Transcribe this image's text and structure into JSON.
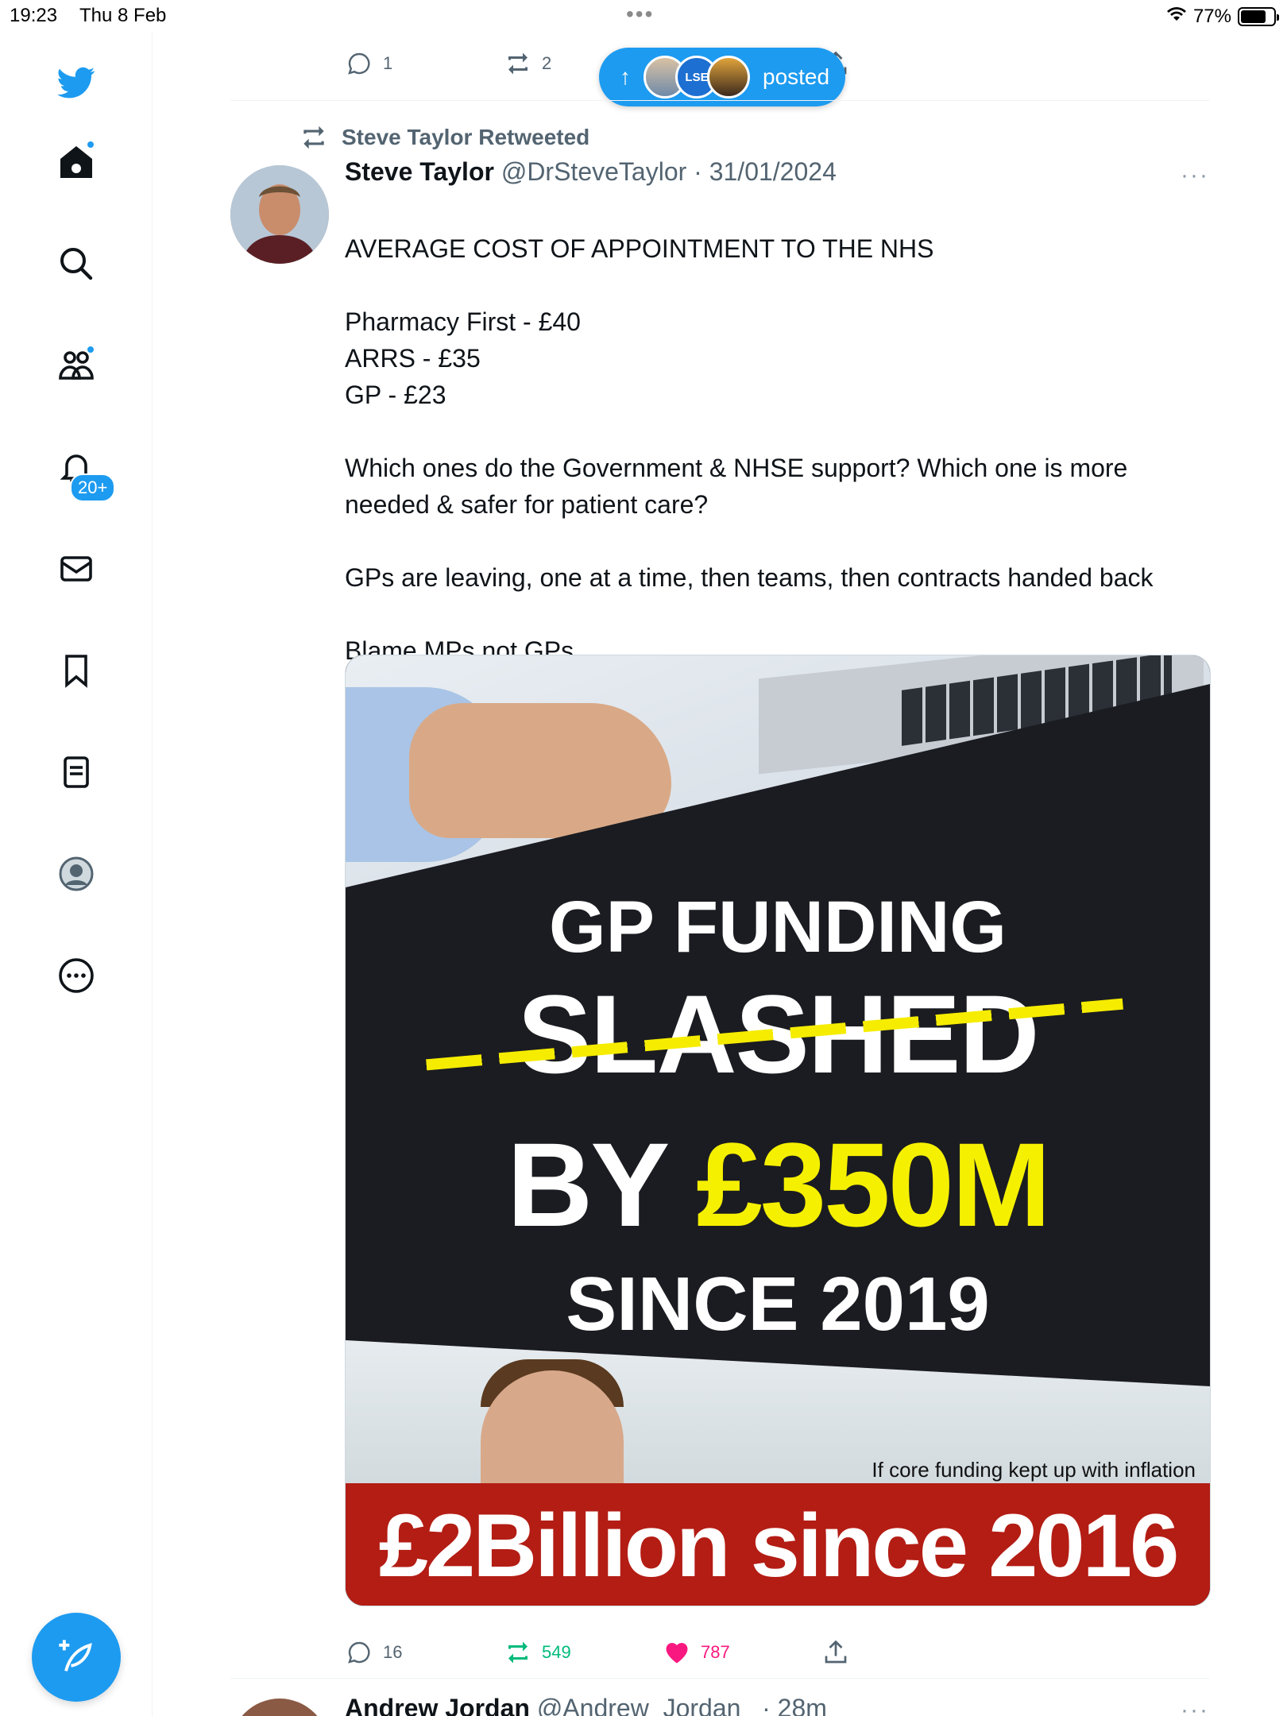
{
  "status": {
    "time": "19:23",
    "date": "Thu 8 Feb",
    "battery": "77%",
    "battery_level": 0.77
  },
  "sidebar": {
    "notification_badge": "20+",
    "items": [
      "home",
      "search",
      "communities",
      "notifications",
      "messages",
      "bookmarks",
      "lists",
      "profile",
      "more"
    ]
  },
  "previous_tweet": {
    "reply_count": "1",
    "retweet_count": "2"
  },
  "posted_pill": {
    "label": "posted",
    "avatar_text": "LSE"
  },
  "tweet": {
    "retweeted_by": "Steve Taylor Retweeted",
    "author_name": "Steve Taylor",
    "handle": "@DrSteveTaylor",
    "date": "31/01/2024",
    "more": "···",
    "lines": [
      "AVERAGE COST OF APPOINTMENT TO THE NHS",
      "",
      "Pharmacy First - £40",
      "ARRS - £35",
      "GP - £23",
      "",
      "Which ones do the Government & NHSE support? Which one is more needed & safer for patient care?",
      "",
      "GPs are leaving, one at a time, then teams, then contracts handed back",
      "",
      "Blame MPs not GPs"
    ],
    "image": {
      "line1": "GP FUNDING",
      "line2": "SLASHED",
      "line3_prefix": "BY ",
      "line3_amount": "£350M",
      "line4": "SINCE 2019",
      "inflation_note": "If core funding kept up with inflation",
      "banner": "£2Billion since 2016"
    },
    "replies": "16",
    "retweets": "549",
    "likes": "787"
  },
  "next_tweet": {
    "author_name": "Andrew Jordan",
    "handle": "@Andrew_Jordan_",
    "time": "28m"
  },
  "colors": {
    "accent": "#1d9bf0",
    "retweet_green": "#00ba7c",
    "like_pink": "#f91880",
    "banner_red": "#b31d14",
    "highlight_yellow": "#f5f000"
  }
}
